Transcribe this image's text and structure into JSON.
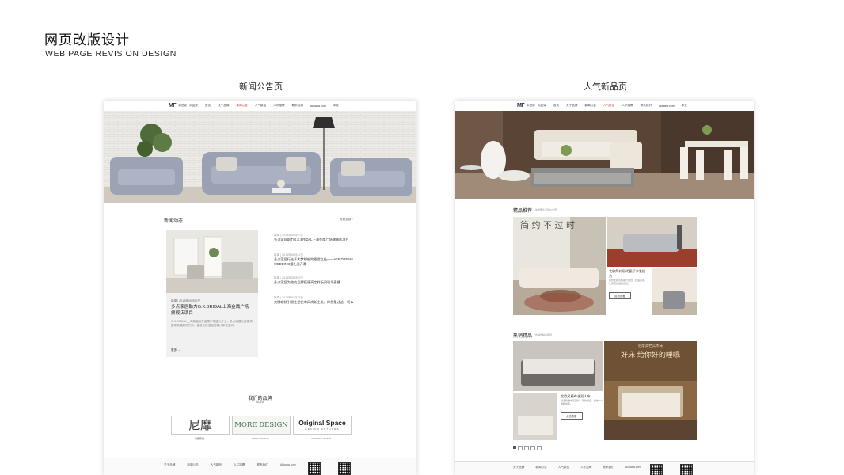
{
  "header": {
    "title": "网页改版设计",
    "subtitle": "WEB PAGE REVISION DESIGN"
  },
  "sections": {
    "left_caption": "新闻公告页",
    "right_caption": "人气新品页"
  },
  "site": {
    "logo": "MF",
    "logo_sub": "米兰家 · 尚品家",
    "nav": [
      "首页",
      "关于品牌",
      "新闻公告",
      "人气新品",
      "人才招聘",
      "联系我们",
      "Alibaba.com",
      "中文"
    ],
    "nav_active_left": "新闻公告",
    "nav_active_right": "人气新品"
  },
  "news_page": {
    "section_title": "新闻动态",
    "more_link": "查看全部  ›",
    "feature": {
      "tag": "新闻  |  2018年09月07日",
      "title": "多点家居助力G.K.BRIDAL上海金鹰广场旗舰店项目",
      "body": "G.K.BRIDAL上海旗舰店在金鹰广场盛大开业，多点家居为其提供整体软装解决方案，营造优雅浪漫的婚纱体验空间。",
      "more": "更多  →"
    },
    "list": [
      {
        "meta": "新闻  |  2018年09月07日",
        "text": "多点家居助力G.K.BRIDAL上海金鹰广场旗舰店项目"
      },
      {
        "meta": "新闻  |  2018年08月21日",
        "text": "多点家居行走于大梦想般的殿堂之处——AFF DREAM WEDDING婚礼秀开幕"
      },
      {
        "meta": "新闻  |  2018年08月02日",
        "text": "多点家居为他的品牌搭建高定样板间现场直播"
      },
      {
        "meta": "新闻  |  2018年07月15日",
        "text": "大牌软装引领生活艺术风尚新主张，你想象过这一切么"
      }
    ],
    "brands_title": "我们的品牌",
    "brands_sub": "BRAND",
    "brands": [
      {
        "logo": "尼靡",
        "name": "尼靡家居"
      },
      {
        "logo": "MORE DESIGN",
        "name": "MORE DESIGN"
      },
      {
        "logo": "Original Space",
        "tagline": "DESIGN FUTURES",
        "name": "ORIGINAL SPACE"
      }
    ],
    "footer": [
      "关于品牌",
      "新闻公告",
      "人气新品",
      "人才招聘",
      "联系我们",
      "Alibaba.com"
    ]
  },
  "product_page": {
    "section1_title": "精品推荐",
    "section1_sub": "你想要生活就在这里",
    "feature_text": "简 约 不 过 时",
    "feature_side": "北欧简约现代客厅沙发组合",
    "feature_desc": "简约北欧风格客厅组合，舒适实用，让家更加温馨自然。",
    "feature_btn": "点击查看",
    "section2_title": "热销精品",
    "section2_sub": "热销的精品推荐",
    "bed_title": "北欧风格布艺双人床",
    "bed_desc": "精选优质布艺面料，简约舒适，给你一个温暖的家。",
    "bed_btn": "点击查看",
    "promo_top": "尼摩高档实木床",
    "promo_main": "好床  给你好的睡眠",
    "footer": [
      "关于品牌",
      "新闻公告",
      "人气新品",
      "人才招聘",
      "联系我们",
      "Alibaba.com"
    ]
  },
  "colors": {
    "accent": "#c0392b",
    "banner_dark": "#5a4436",
    "sofa_gray": "#9ca3b5"
  }
}
